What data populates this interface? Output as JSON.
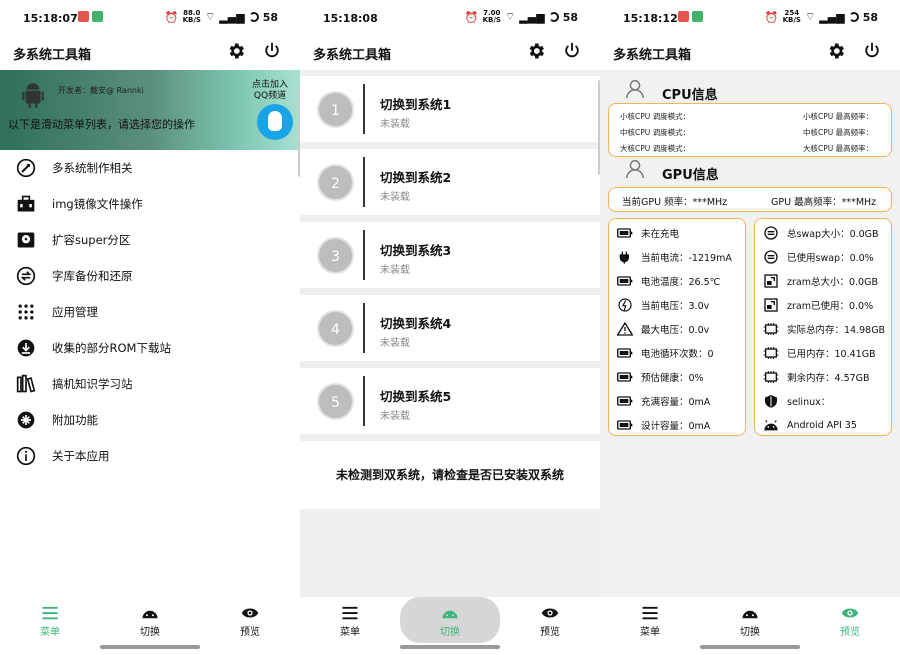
{
  "status": [
    {
      "time": "15:18:07",
      "speed": "88.0",
      "speed_unit": "KB/S",
      "battery": "58"
    },
    {
      "time": "15:18:08",
      "speed": "7.00",
      "speed_unit": "KB/S",
      "battery": "58"
    },
    {
      "time": "15:18:12",
      "speed": "254",
      "speed_unit": "KB/S",
      "battery": "58"
    }
  ],
  "app_title": "多系统工具箱",
  "colors": {
    "accent": "#3db57c",
    "orange_border": "#f0b25a",
    "banner_start": "#2f6f5c",
    "banner_end": "#a8e0d2"
  },
  "menu_panel": {
    "developer": "开发者：戴安@ Rannki",
    "join_line1": "点击加入",
    "join_line2": "QQ频道",
    "hint": "以下是滑动菜单列表，请选择您的操作",
    "items": [
      {
        "icon": "wrench-icon",
        "label": "多系统制作相关"
      },
      {
        "icon": "toolbox-icon",
        "label": "img镜像文件操作"
      },
      {
        "icon": "harddisk-icon",
        "label": "扩容super分区"
      },
      {
        "icon": "sync-icon",
        "label": "字库备份和还原"
      },
      {
        "icon": "apps-grid-icon",
        "label": "应用管理"
      },
      {
        "icon": "download-icon",
        "label": "收集的部分ROM下载站"
      },
      {
        "icon": "library-icon",
        "label": "搞机知识学习站"
      },
      {
        "icon": "extension-icon",
        "label": "附加功能"
      },
      {
        "icon": "info-icon",
        "label": "关于本应用"
      }
    ]
  },
  "switch_panel": {
    "systems": [
      {
        "num": "1",
        "title": "切换到系统1",
        "status": "未装载"
      },
      {
        "num": "2",
        "title": "切换到系统2",
        "status": "未装载"
      },
      {
        "num": "3",
        "title": "切换到系统3",
        "status": "未装载"
      },
      {
        "num": "4",
        "title": "切换到系统4",
        "status": "未装载"
      },
      {
        "num": "5",
        "title": "切换到系统5",
        "status": "未装载"
      }
    ],
    "notice": "未检测到双系统，请检查是否已安装双系统"
  },
  "preview_panel": {
    "cpu_title": "CPU信息",
    "cpu_rows": [
      {
        "left": "小核CPU 调度模式：",
        "right": "小核CPU 最高频率："
      },
      {
        "left": "中核CPU 调度模式：",
        "right": "中核CPU 最高频率："
      },
      {
        "left": "大核CPU 调度模式：",
        "right": "大核CPU 最高频率："
      }
    ],
    "gpu_title": "GPU信息",
    "gpu_current": "当前GPU 频率：***MHz",
    "gpu_max": "GPU 最高频率：***MHz",
    "battery_stats": [
      {
        "icon": "battery-icon",
        "label": "未在充电"
      },
      {
        "icon": "plug-icon",
        "label": "当前电流：-1219mA"
      },
      {
        "icon": "battery-temp-icon",
        "label": "电池温度：26.5℃"
      },
      {
        "icon": "voltage-icon",
        "label": "当前电压：3.0v"
      },
      {
        "icon": "warning-icon",
        "label": "最大电压：0.0v"
      },
      {
        "icon": "battery-cycle-icon",
        "label": "电池循环次数：0"
      },
      {
        "icon": "battery-health-icon",
        "label": "预估健康：0%"
      },
      {
        "icon": "battery-charge-icon",
        "label": "充满容量：0mA"
      },
      {
        "icon": "battery-full-icon",
        "label": "设计容量：0mA"
      }
    ],
    "memory_stats": [
      {
        "icon": "swap-icon",
        "label": "总swap大小：0.0GB"
      },
      {
        "icon": "swap-used-icon",
        "label": "已使用swap：0.0%"
      },
      {
        "icon": "zram-icon",
        "label": "zram总大小：0.0GB"
      },
      {
        "icon": "zram-used-icon",
        "label": "zram已使用：0.0%"
      },
      {
        "icon": "memory-icon",
        "label": "实际总内存：14.98GB"
      },
      {
        "icon": "memory-used-icon",
        "label": "已用内存：10.41GB"
      },
      {
        "icon": "memory-free-icon",
        "label": "剩余内存：4.57GB"
      },
      {
        "icon": "shield-icon",
        "label": "selinux："
      },
      {
        "icon": "android-icon",
        "label": "Android API 35"
      }
    ]
  },
  "nav": [
    {
      "icon": "menu-icon",
      "label": "菜单"
    },
    {
      "icon": "android-icon",
      "label": "切换"
    },
    {
      "icon": "eye-icon",
      "label": "预览"
    }
  ]
}
